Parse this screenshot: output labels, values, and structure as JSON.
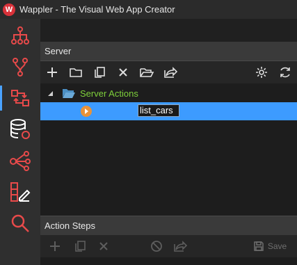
{
  "window": {
    "title": "Wappler - The Visual Web App Creator",
    "logo_letter": "W"
  },
  "sidebar": {
    "items": [
      {
        "icon": "tree-structure-icon"
      },
      {
        "icon": "git-branch-icon"
      },
      {
        "icon": "server-connect-icon",
        "active": true
      },
      {
        "icon": "database-icon"
      },
      {
        "icon": "share-nodes-icon"
      },
      {
        "icon": "design-tools-icon"
      },
      {
        "icon": "search-icon"
      }
    ]
  },
  "server_panel": {
    "title": "Server",
    "toolbar": [
      "add-icon",
      "folder-icon",
      "copy-icon",
      "delete-icon",
      "open-folder-icon",
      "export-icon",
      "settings-icon",
      "refresh-icon"
    ]
  },
  "tree": {
    "root_label": "Server Actions",
    "child_value": "list_cars"
  },
  "action_steps": {
    "title": "Action Steps",
    "save_label": "Save"
  },
  "colors": {
    "accent": "#3d9bff",
    "root_label": "#7fd13b",
    "brand": "#d9323a",
    "icon_red": "#e84a4a"
  }
}
